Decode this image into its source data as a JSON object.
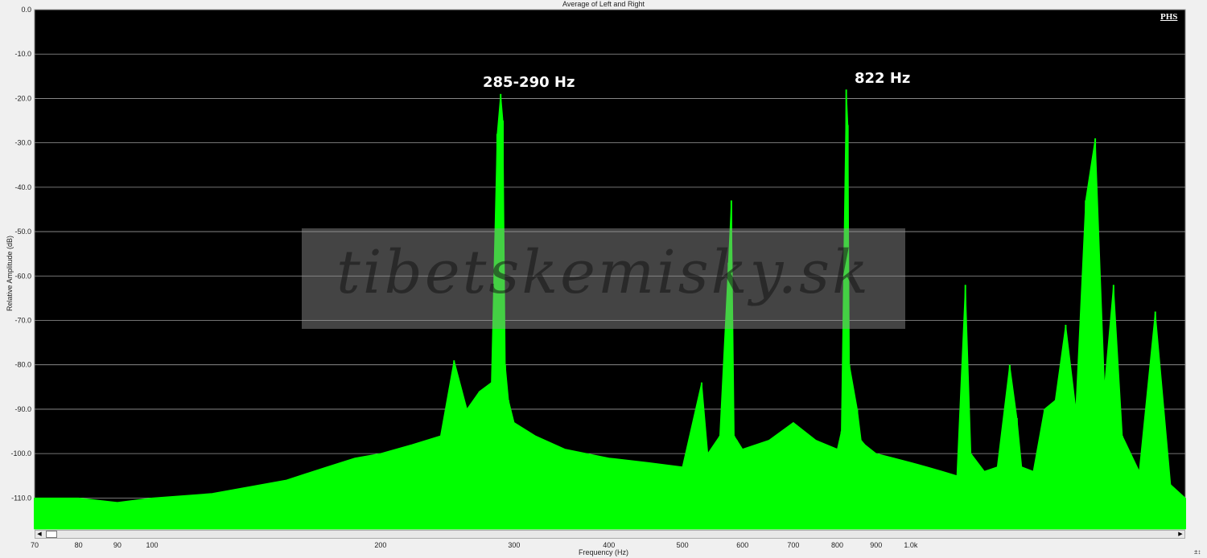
{
  "window": {
    "corner_mark": "PHS"
  },
  "watermark": "tibetskemisky.sk",
  "peak_labels": [
    "285-290 Hz",
    "822 Hz"
  ],
  "chart_data": {
    "type": "area",
    "title": "Average of Left and Right",
    "xlabel": "Frequency (Hz)",
    "ylabel": "Relative Amplitude (dB)",
    "x_scale": "log",
    "xlim": [
      70,
      2300
    ],
    "ylim": [
      -117,
      0
    ],
    "x_ticks": [
      {
        "value": 70,
        "label": "70"
      },
      {
        "value": 80,
        "label": "80"
      },
      {
        "value": 90,
        "label": "90"
      },
      {
        "value": 100,
        "label": "100"
      },
      {
        "value": 200,
        "label": "200"
      },
      {
        "value": 300,
        "label": "300"
      },
      {
        "value": 400,
        "label": "400"
      },
      {
        "value": 500,
        "label": "500"
      },
      {
        "value": 600,
        "label": "600"
      },
      {
        "value": 700,
        "label": "700"
      },
      {
        "value": 800,
        "label": "800"
      },
      {
        "value": 900,
        "label": "900"
      },
      {
        "value": 1000,
        "label": "1.0k"
      }
    ],
    "y_ticks": [
      0,
      -10,
      -20,
      -30,
      -40,
      -50,
      -60,
      -70,
      -80,
      -90,
      -100,
      -110
    ],
    "y_tick_labels": [
      "0.0",
      "-10.0",
      "-20.0",
      "-30.0",
      "-40.0",
      "-50.0",
      "-60.0",
      "-70.0",
      "-80.0",
      "-90.0",
      "-100.0",
      "-110.0"
    ],
    "grid": true,
    "colors": {
      "plot_bg": "#000000",
      "series": "#00ff00",
      "grid": "#9a9a9a"
    },
    "series": [
      {
        "x": [
          70,
          80,
          90,
          100,
          120,
          150,
          170,
          185,
          200,
          220,
          240,
          250,
          260,
          270,
          280,
          285,
          288,
          290,
          292,
          295,
          300,
          320,
          350,
          400,
          450,
          500,
          530,
          540,
          560,
          575,
          580,
          585,
          590,
          600,
          650,
          700,
          750,
          800,
          810,
          822,
          826,
          830,
          850,
          860,
          870,
          900,
          950,
          1000,
          1050,
          1100,
          1150,
          1180,
          1200,
          1250,
          1300,
          1350,
          1380,
          1400,
          1450,
          1500,
          1550,
          1600,
          1650,
          1700,
          1750,
          1800,
          1850,
          1900,
          2000,
          2100,
          2200,
          2300
        ],
        "y": [
          -110,
          -110,
          -111,
          -110,
          -109,
          -106,
          -103,
          -101,
          -100,
          -98,
          -96,
          -79,
          -90,
          -86,
          -84,
          -28,
          -19,
          -25,
          -80,
          -88,
          -93,
          -96,
          -99,
          -101,
          -102,
          -103,
          -84,
          -100,
          -96,
          -57,
          -43,
          -96,
          -97,
          -99,
          -97,
          -93,
          -97,
          -99,
          -95,
          -18,
          -26,
          -80,
          -90,
          -97,
          -98,
          -100,
          -101,
          -102,
          -103,
          -104,
          -105,
          -62,
          -100,
          -104,
          -103,
          -80,
          -92,
          -103,
          -104,
          -90,
          -88,
          -71,
          -90,
          -43,
          -29,
          -85,
          -62,
          -96,
          -104,
          -68,
          -107,
          -110
        ]
      }
    ]
  }
}
